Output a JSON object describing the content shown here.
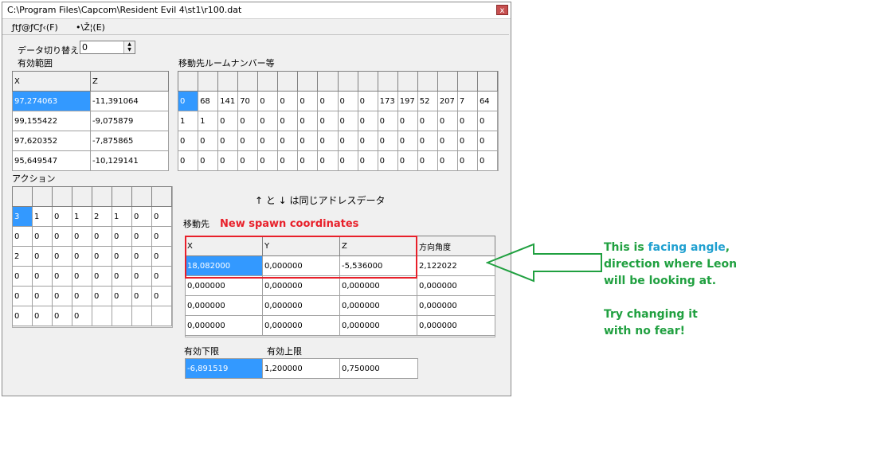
{
  "window": {
    "title": "C:\\Program Files\\Capcom\\Resident Evil 4\\st1\\r100.dat",
    "close": "x"
  },
  "menu": {
    "file": "ƒtƒ@ƒCƒ‹(F)",
    "view": "•\\Ž¦(E)"
  },
  "data_switch": {
    "label": "データ切り替え",
    "value": "0"
  },
  "valid_range": {
    "label": "有効範囲",
    "headers": [
      "X",
      "Z"
    ],
    "rows": [
      [
        "97,274063",
        "-11,391064"
      ],
      [
        "99,155422",
        "-9,075879"
      ],
      [
        "97,620352",
        "-7,875865"
      ],
      [
        "95,649547",
        "-10,129141"
      ]
    ]
  },
  "room_number": {
    "label": "移動先ルームナンバー等",
    "rows": [
      [
        "0",
        "68",
        "141",
        "70",
        "0",
        "0",
        "0",
        "0",
        "0",
        "0",
        "173",
        "197",
        "52",
        "207",
        "7",
        "64"
      ],
      [
        "1",
        "1",
        "0",
        "0",
        "0",
        "0",
        "0",
        "0",
        "0",
        "0",
        "0",
        "0",
        "0",
        "0",
        "0",
        "0"
      ],
      [
        "0",
        "0",
        "0",
        "0",
        "0",
        "0",
        "0",
        "0",
        "0",
        "0",
        "0",
        "0",
        "0",
        "0",
        "0",
        "0"
      ],
      [
        "0",
        "0",
        "0",
        "0",
        "0",
        "0",
        "0",
        "0",
        "0",
        "0",
        "0",
        "0",
        "0",
        "0",
        "0",
        "0"
      ]
    ]
  },
  "action": {
    "label": "アクション",
    "rows": [
      [
        "3",
        "1",
        "0",
        "1",
        "2",
        "1",
        "0",
        "0"
      ],
      [
        "0",
        "0",
        "0",
        "0",
        "0",
        "0",
        "0",
        "0"
      ],
      [
        "2",
        "0",
        "0",
        "0",
        "0",
        "0",
        "0",
        "0"
      ],
      [
        "0",
        "0",
        "0",
        "0",
        "0",
        "0",
        "0",
        "0"
      ],
      [
        "0",
        "0",
        "0",
        "0",
        "0",
        "0",
        "0",
        "0"
      ],
      [
        "0",
        "0",
        "0",
        "0",
        "",
        "",
        "",
        ""
      ]
    ]
  },
  "same_address_note": "↑ と ↓ は同じアドレスデータ",
  "destination": {
    "label": "移動先",
    "headers": [
      "X",
      "Y",
      "Z",
      "方向角度"
    ],
    "rows": [
      [
        "18,082000",
        "0,000000",
        "-5,536000",
        "2,122022"
      ],
      [
        "0,000000",
        "0,000000",
        "0,000000",
        "0,000000"
      ],
      [
        "0,000000",
        "0,000000",
        "0,000000",
        "0,000000"
      ],
      [
        "0,000000",
        "0,000000",
        "0,000000",
        "0,000000"
      ]
    ]
  },
  "limits": {
    "lower_label": "有効下限",
    "upper_label": "有効上限",
    "values": [
      "-6,891519",
      "1,200000",
      "0,750000"
    ]
  },
  "annotations": {
    "spawn": "New spawn coordinates",
    "facing_pre": "This is ",
    "facing_word": "facing angle",
    "facing_post": ",",
    "line2": "direction where Leon",
    "line3": "will be looking at.",
    "line4": "Try changing it",
    "line5": "with no fear!"
  },
  "colors": {
    "selection": "#3399ff",
    "red": "#e8202a",
    "green": "#20a040",
    "blue": "#20a0d0"
  }
}
